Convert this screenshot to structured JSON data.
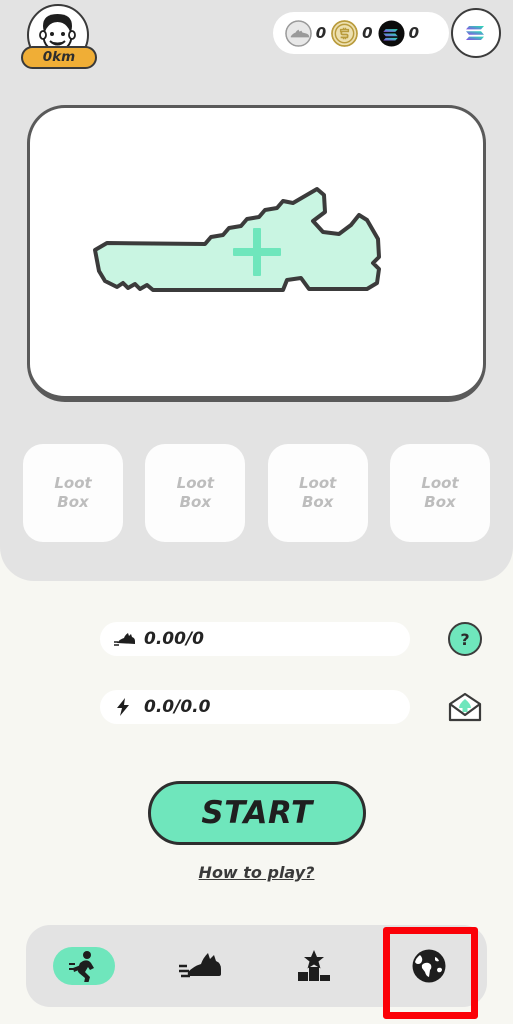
{
  "app": {
    "background_color": "#F7F7F2",
    "panel_color": "#E3E3E3",
    "accent_mint": "#6FE6BC",
    "accent_gold": "#F0AE36",
    "highlight_red": "#FB0007"
  },
  "header": {
    "avatar": {
      "name": "avatar",
      "distance_label": "0km"
    },
    "currencies": [
      {
        "icon": "sneaker-token-icon",
        "label": "sneaker token",
        "value": "0"
      },
      {
        "icon": "gold-coin-icon",
        "label": "gold coin",
        "value": "0"
      },
      {
        "icon": "solana-token-icon",
        "label": "solana token",
        "value": "0"
      }
    ],
    "wallet_button": {
      "icon": "solana-logo-icon",
      "label": "Solana wallet"
    }
  },
  "shoe_card": {
    "name": "sneaker-slot",
    "icon": "sneaker-outline-icon",
    "action_icon": "plus-icon",
    "empty": true
  },
  "lootboxes": [
    {
      "line1": "Loot",
      "line2": "Box"
    },
    {
      "line1": "Loot",
      "line2": "Box"
    },
    {
      "line1": "Loot",
      "line2": "Box"
    },
    {
      "line1": "Loot",
      "line2": "Box"
    }
  ],
  "stats": [
    {
      "icon": "running-shoe-icon",
      "value": "0.00/0",
      "action_icon": "question-mark-icon",
      "action_label": "?"
    },
    {
      "icon": "lightning-bolt-icon",
      "value": "0.0/0.0",
      "action_icon": "mail-envelope-icon"
    }
  ],
  "actions": {
    "start_label": "START",
    "how_to_play_label": "How to play?"
  },
  "nav": {
    "items": [
      {
        "icon": "running-person-icon",
        "label": "run",
        "active": true
      },
      {
        "icon": "sneaker-icon",
        "label": "shoes",
        "active": false
      },
      {
        "icon": "podium-star-icon",
        "label": "leaderboard",
        "active": false
      },
      {
        "icon": "globe-icon",
        "label": "world",
        "active": false
      }
    ],
    "highlighted_index": 3
  }
}
